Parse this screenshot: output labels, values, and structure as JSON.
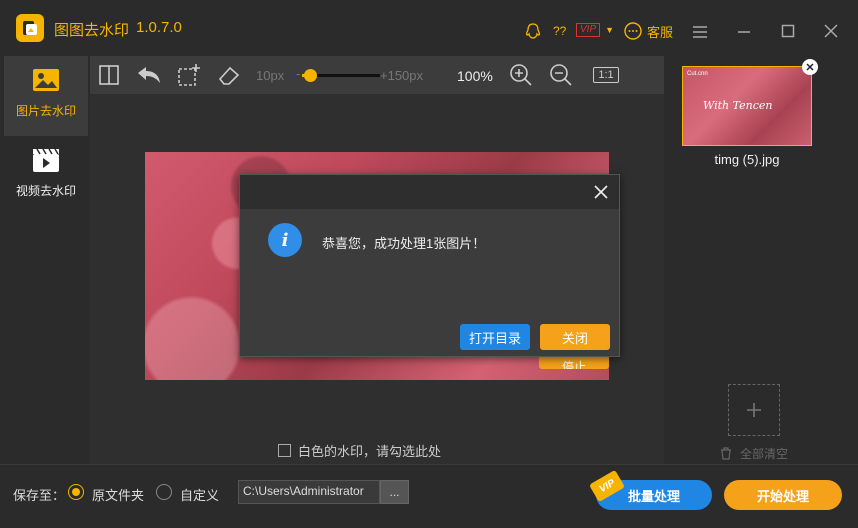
{
  "app": {
    "title": "图图去水印",
    "version": "1.0.7.0",
    "help_label": "??",
    "vip_label": "VIP",
    "service_label": "客服"
  },
  "sidebar": {
    "items": [
      {
        "label": "图片去水印",
        "icon": "image-icon",
        "active": true
      },
      {
        "label": "视频去水印",
        "icon": "video-icon",
        "active": false
      }
    ]
  },
  "toolbar": {
    "brush_min": "10px",
    "brush_max": "+150px",
    "brush_level": 0.1,
    "zoom": "100%",
    "actual_size_label": "1:1"
  },
  "canvas": {
    "white_watermark_label": "白色的水印，请勾选此处",
    "white_watermark_checked": false,
    "stop_label": "停止"
  },
  "dialog": {
    "message": "恭喜您，成功处理1张图片！",
    "open_folder_label": "打开目录",
    "close_label": "关闭"
  },
  "files": {
    "items": [
      {
        "name": "timg (5).jpg",
        "thumb_text": "With Tencen",
        "thumb_small": "Cut.cnn"
      }
    ],
    "clear_all_label": "全部清空"
  },
  "output": {
    "save_to_label": "保存至：",
    "option_original": "原文件夹",
    "option_custom": "自定义",
    "selected": "original",
    "path": "C:\\Users\\Administrator",
    "browse_label": "...",
    "batch_label": "批量处理",
    "batch_badge": "VIP",
    "start_label": "开始处理"
  },
  "colors": {
    "accent": "#f5b400",
    "blue": "#1f86e4",
    "orange": "#f5a21a"
  }
}
